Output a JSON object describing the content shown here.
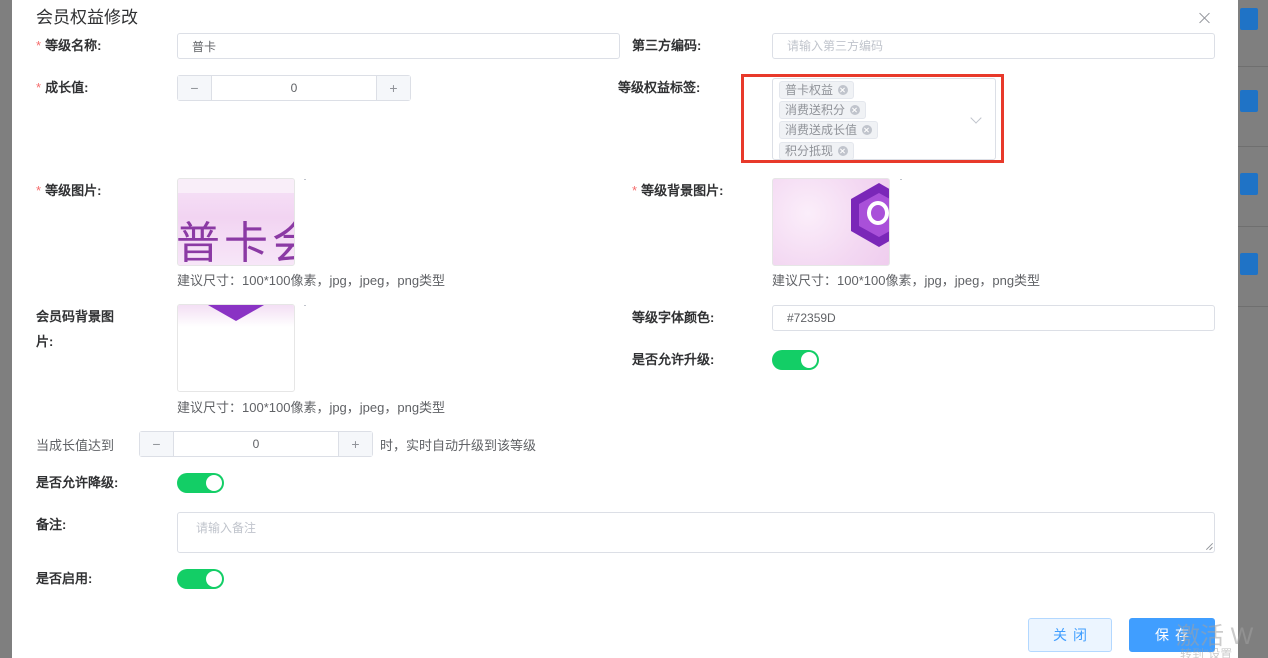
{
  "dialog": {
    "title": "会员权益修改"
  },
  "form": {
    "level_name": {
      "label": "等级名称:",
      "value": "普卡"
    },
    "third_code": {
      "label": "第三方编码:",
      "value": "",
      "placeholder": "请输入第三方编码"
    },
    "growth": {
      "label": "成长值:",
      "minus": "−",
      "value": "0",
      "plus": "+"
    },
    "benefit_tags": {
      "label": "等级权益标签:",
      "tags": [
        "普卡权益",
        "消费送积分",
        "消费送成长值",
        "积分抵现"
      ]
    },
    "level_image": {
      "label": "等级图片:",
      "image_text": "普卡会",
      "hint": "建议尺寸：100*100像素，jpg，jpeg，png类型"
    },
    "level_bg_image": {
      "label": "等级背景图片:",
      "hint": "建议尺寸：100*100像素，jpg，jpeg，png类型"
    },
    "code_bg_image": {
      "label_line1": "会员码背景图",
      "label_line2": "片:",
      "hint": "建议尺寸：100*100像素，jpg，jpeg，png类型"
    },
    "font_color": {
      "label": "等级字体颜色:",
      "value": "#72359D"
    },
    "allow_upgrade": {
      "label": "是否允许升级:",
      "on": true
    },
    "auto_upgrade": {
      "prefix": "当成长值达到",
      "minus": "−",
      "value": "0",
      "plus": "+",
      "suffix": "时，实时自动升级到该等级"
    },
    "allow_downgrade": {
      "label": "是否允许降级:",
      "on": true
    },
    "remark": {
      "label": "备注:",
      "value": "",
      "placeholder": "请输入备注"
    },
    "enabled": {
      "label": "是否启用:",
      "on": true
    }
  },
  "footer": {
    "close_label": "关闭",
    "save_label": "保存"
  },
  "overlay": {
    "watermark": "激活 W",
    "watermark_sub": "转到\"设置"
  },
  "colors": {
    "accent": "#409eff",
    "switch_on": "#13ce66",
    "highlight": "#e8392a",
    "required": "#f56c6c"
  }
}
